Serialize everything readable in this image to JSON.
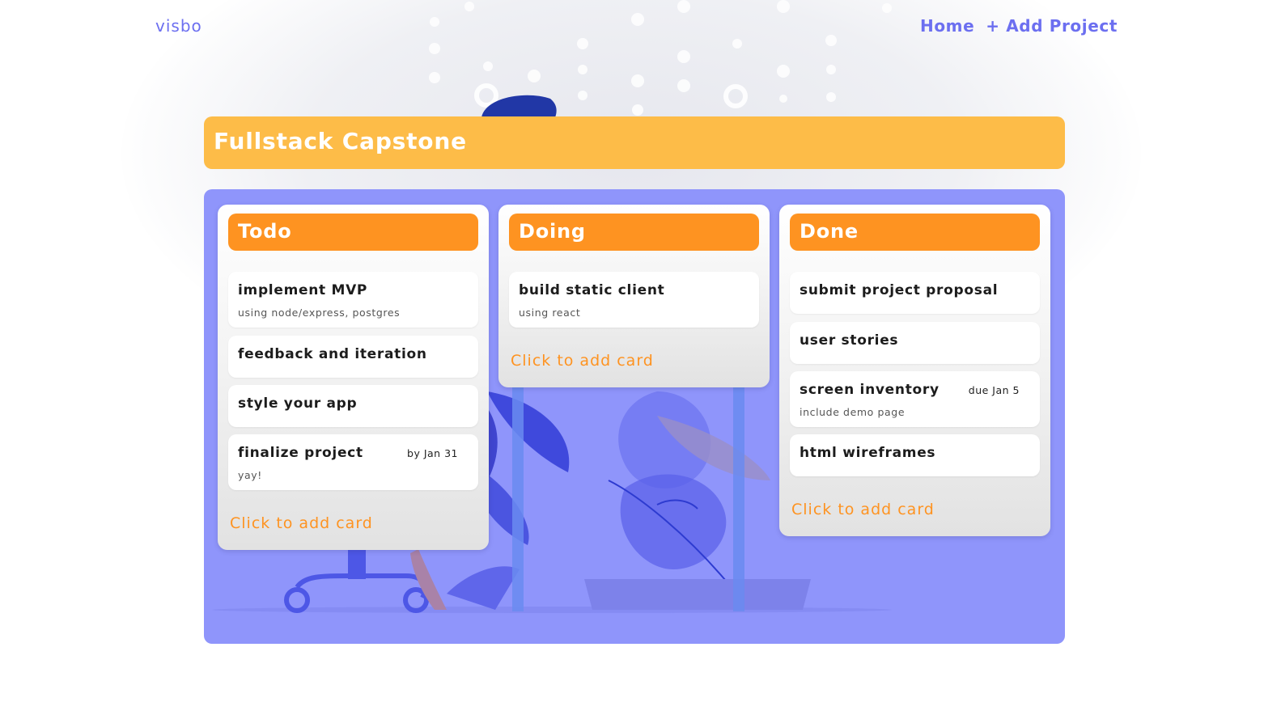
{
  "nav": {
    "brand": "visbo",
    "links": [
      "Home",
      "+ Add Project"
    ]
  },
  "project": {
    "title": "Fullstack Capstone"
  },
  "lists": [
    {
      "title": "Todo",
      "cards": [
        {
          "title": "implement MVP",
          "description": "using node/express, postgres",
          "due": ""
        },
        {
          "title": "feedback and iteration",
          "description": "",
          "due": ""
        },
        {
          "title": "style your app",
          "description": "",
          "due": ""
        },
        {
          "title": "finalize project",
          "description": "yay!",
          "due": "by Jan 31"
        }
      ],
      "add_card_label": "Click to add card"
    },
    {
      "title": "Doing",
      "cards": [
        {
          "title": "build static client",
          "description": "using react",
          "due": ""
        }
      ],
      "add_card_label": "Click to add card"
    },
    {
      "title": "Done",
      "cards": [
        {
          "title": "submit project proposal",
          "description": "",
          "due": ""
        },
        {
          "title": "user stories",
          "description": "",
          "due": ""
        },
        {
          "title": "screen inventory",
          "description": "include demo page",
          "due": "due Jan 5"
        },
        {
          "title": "html wireframes",
          "description": "",
          "due": ""
        }
      ],
      "add_card_label": "Click to add card"
    }
  ],
  "colors": {
    "brand": "#6c6ff0",
    "project_header": "#fdbc48",
    "list_header": "#fe9321",
    "board": "#8f95fb",
    "card": "#ffffff"
  }
}
